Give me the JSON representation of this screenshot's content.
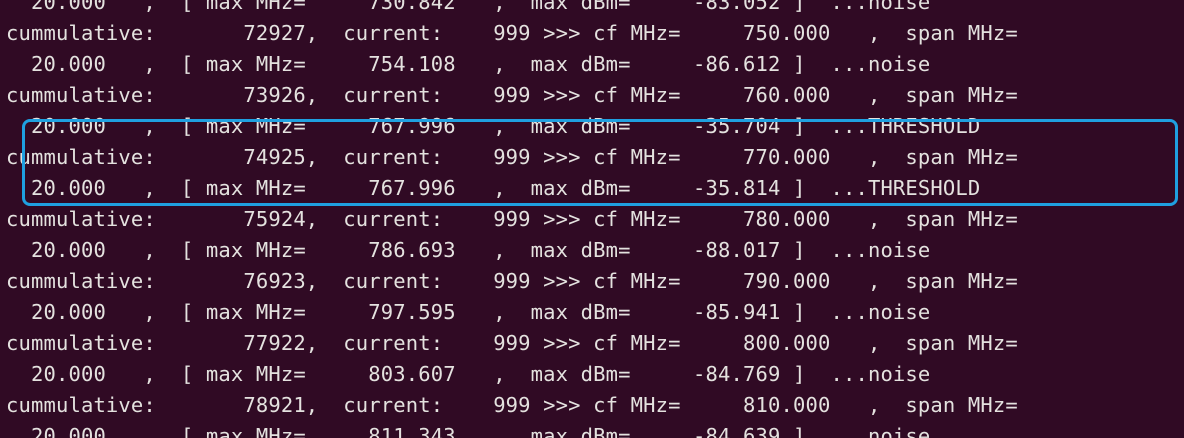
{
  "terminal": {
    "lines": [
      "  20.000   ,  [ max MHz=     730.842   ,  max dBm=     -83.052 ]  ...noise",
      "cummulative:       72927,  current:    999 >>> cf MHz=     750.000   ,  span MHz=",
      "  20.000   ,  [ max MHz=     754.108   ,  max dBm=     -86.612 ]  ...noise",
      "cummulative:       73926,  current:    999 >>> cf MHz=     760.000   ,  span MHz=",
      "  20.000   ,  [ max MHz=     767.996   ,  max dBm=     -35.704 ]  ...THRESHOLD",
      "cummulative:       74925,  current:    999 >>> cf MHz=     770.000   ,  span MHz=",
      "  20.000   ,  [ max MHz=     767.996   ,  max dBm=     -35.814 ]  ...THRESHOLD",
      "cummulative:       75924,  current:    999 >>> cf MHz=     780.000   ,  span MHz=",
      "  20.000   ,  [ max MHz=     786.693   ,  max dBm=     -88.017 ]  ...noise",
      "cummulative:       76923,  current:    999 >>> cf MHz=     790.000   ,  span MHz=",
      "  20.000   ,  [ max MHz=     797.595   ,  max dBm=     -85.941 ]  ...noise",
      "cummulative:       77922,  current:    999 >>> cf MHz=     800.000   ,  span MHz=",
      "  20.000   ,  [ max MHz=     803.607   ,  max dBm=     -84.769 ]  ...noise",
      "cummulative:       78921,  current:    999 >>> cf MHz=     810.000   ,  span MHz=",
      "  20.000   ,  [ max MHz=     811.343   ,  max dBm=     -84.639 ]  ...noise"
    ]
  },
  "colors": {
    "background": "#300a24",
    "text": "#e4e2df",
    "highlight": "#1fa0e0"
  }
}
